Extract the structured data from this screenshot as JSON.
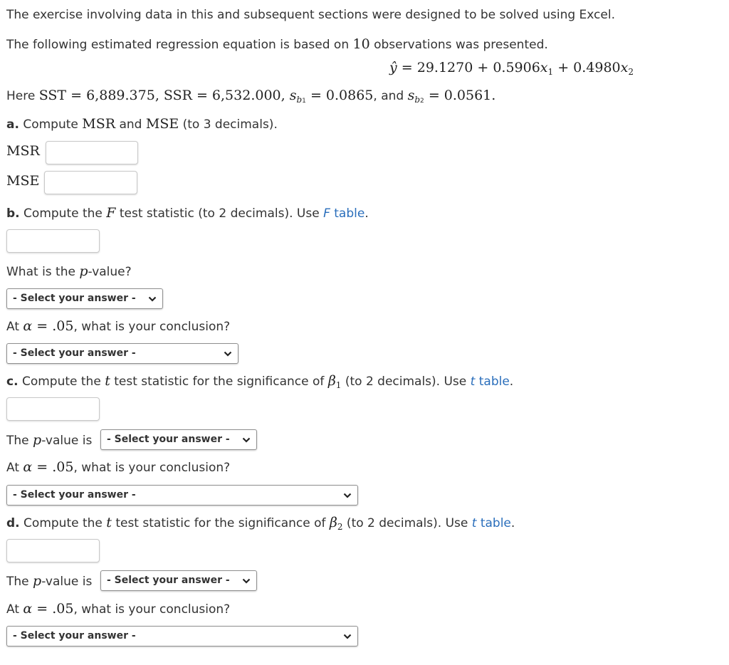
{
  "intro": {
    "line1": "The exercise involving data in this and subsequent sections were designed to be solved using Excel.",
    "line2_pre": "The following estimated regression equation is based on ",
    "line2_n": "10",
    "line2_post": " observations was presented.",
    "equation": {
      "lhs": "ŷ",
      "eq": " = ",
      "b0": "29.1270",
      "plus1": " + ",
      "b1": "0.5906",
      "x1": "x",
      "x1_sub": "1",
      "plus2": " + ",
      "b2": "0.4980",
      "x2": "x",
      "x2_sub": "2"
    },
    "given": {
      "here": "Here ",
      "sst_label": "SST",
      "sst_value": " = 6,889.375",
      "comma1": ", ",
      "ssr_label": "SSR",
      "ssr_value": " = 6,532.000",
      "comma2": ", ",
      "sb1_s": "s",
      "sb1_sub": "b",
      "sb1_subsub": "1",
      "sb1_value": " = 0.0865",
      "and": ", and ",
      "sb2_s": "s",
      "sb2_sub": "b",
      "sb2_subsub": "2",
      "sb2_value": " = 0.0561",
      "period": "."
    }
  },
  "part_a": {
    "letter": "a.",
    "text_pre": " Compute ",
    "msr": "MSR",
    "and": " and ",
    "mse": "MSE",
    "text_post": " (to 3 decimals).",
    "msr_label": "MSR",
    "mse_label": "MSE",
    "msr_value": "",
    "mse_value": ""
  },
  "part_b": {
    "letter": "b.",
    "text_pre": " Compute the ",
    "stat": "F",
    "text_post": " test statistic (to 2 decimals). Use ",
    "link_italic": "F",
    "link_text": " table",
    "period": ".",
    "f_value": "",
    "pvalue_q_pre": "What is the ",
    "pvalue_q_p": "p",
    "pvalue_q_post": "-value?",
    "pvalue_select": "- Select your answer -",
    "conclusion_pre": "At ",
    "alpha": "α",
    "alpha_eq": " = .05",
    "conclusion_post": ", what is your conclusion?",
    "conclusion_select": "- Select your answer -"
  },
  "part_c": {
    "letter": "c.",
    "text_pre": " Compute the ",
    "stat": "t",
    "text_mid": " test statistic for the significance of ",
    "beta": "β",
    "beta_sub": "1",
    "text_post": " (to 2 decimals). Use ",
    "link_italic": "t",
    "link_text": " table",
    "period": ".",
    "t_value": "",
    "pvalue_pre": "The ",
    "pvalue_p": "p",
    "pvalue_post": "-value is",
    "pvalue_select": "- Select your answer -",
    "conclusion_pre": "At ",
    "alpha": "α",
    "alpha_eq": " = .05",
    "conclusion_post": ", what is your conclusion?",
    "conclusion_select": "- Select your answer -"
  },
  "part_d": {
    "letter": "d.",
    "text_pre": " Compute the ",
    "stat": "t",
    "text_mid": " test statistic for the significance of ",
    "beta": "β",
    "beta_sub": "2",
    "text_post": " (to 2 decimals). Use ",
    "link_italic": "t",
    "link_text": " table",
    "period": ".",
    "t_value": "",
    "pvalue_pre": "The ",
    "pvalue_p": "p",
    "pvalue_post": "-value is",
    "pvalue_select": "- Select your answer -",
    "conclusion_pre": "At ",
    "alpha": "α",
    "alpha_eq": " = .05",
    "conclusion_post": ", what is your conclusion?",
    "conclusion_select": "- Select your answer -"
  },
  "colors": {
    "link": "#2a6ebb",
    "text": "#333333"
  },
  "icons": {
    "dropdown": "chevron-down-icon"
  }
}
